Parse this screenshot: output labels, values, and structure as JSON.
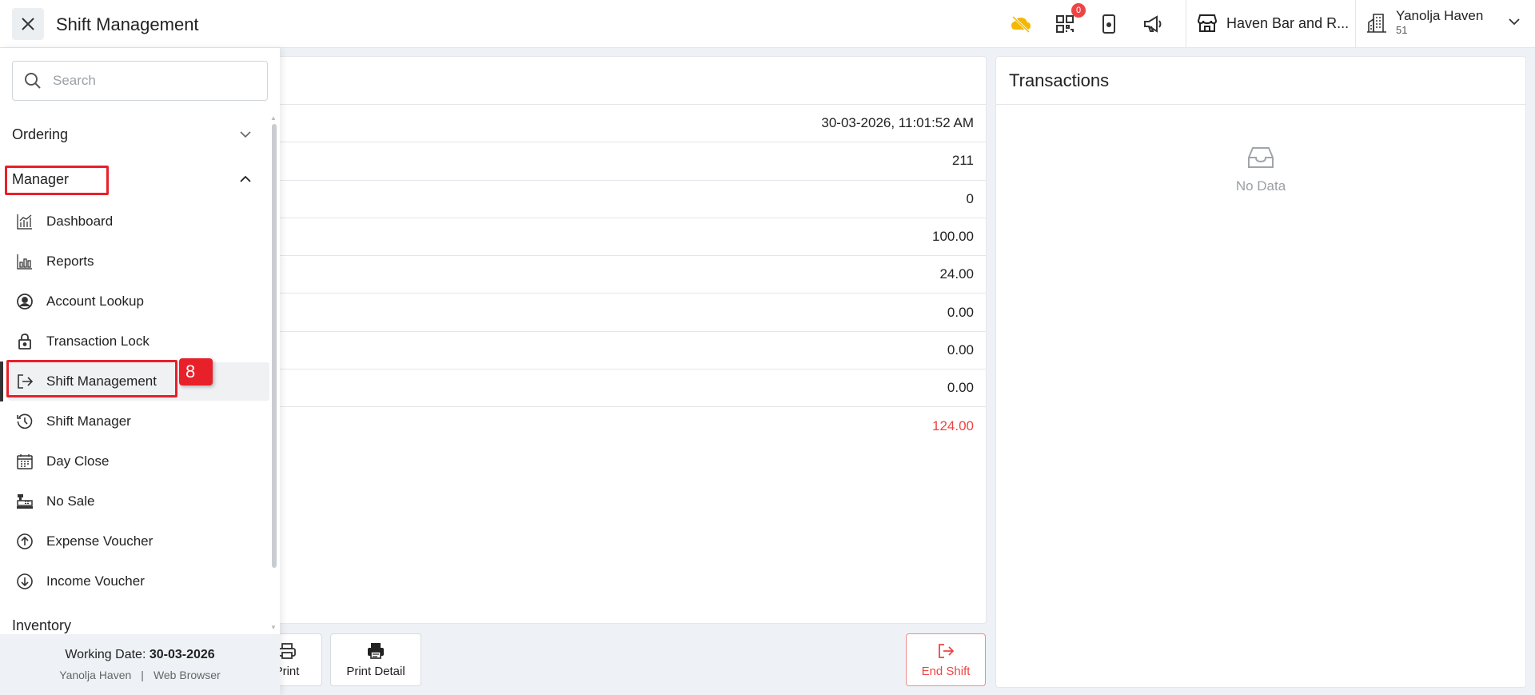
{
  "header": {
    "title": "Shift Management",
    "notification_count": "0",
    "store_name": "Haven Bar and R...",
    "user_name": "Yanolja Haven",
    "user_sub": "51"
  },
  "sidebar": {
    "search_placeholder": "Search",
    "sections": {
      "ordering": "Ordering",
      "manager": "Manager",
      "inventory": "Inventory"
    },
    "items": [
      {
        "label": "Dashboard"
      },
      {
        "label": "Reports"
      },
      {
        "label": "Account Lookup"
      },
      {
        "label": "Transaction Lock"
      },
      {
        "label": "Shift Management"
      },
      {
        "label": "Shift Manager"
      },
      {
        "label": "Day Close"
      },
      {
        "label": "No Sale"
      },
      {
        "label": "Expense Voucher"
      },
      {
        "label": "Income Voucher"
      }
    ],
    "footer": {
      "working_date_label": "Working Date:",
      "working_date": "30-03-2026",
      "property": "Yanolja Haven",
      "separator": "|",
      "client": "Web Browser"
    }
  },
  "summary": {
    "rows": [
      "30-03-2026, 11:01:52 AM",
      "211",
      "0",
      "100.00",
      "24.00",
      "0.00",
      "0.00",
      "0.00",
      "124.00"
    ]
  },
  "transactions": {
    "title": "Transactions",
    "empty_text": "No Data"
  },
  "actions": {
    "print": "Print",
    "print_detail": "Print Detail",
    "end_shift": "End Shift"
  },
  "annotation": {
    "step_number": "8"
  },
  "colors": {
    "accent_red": "#ef4444",
    "annotation_red": "#e8202a",
    "cloud_yellow": "#f5b800"
  }
}
